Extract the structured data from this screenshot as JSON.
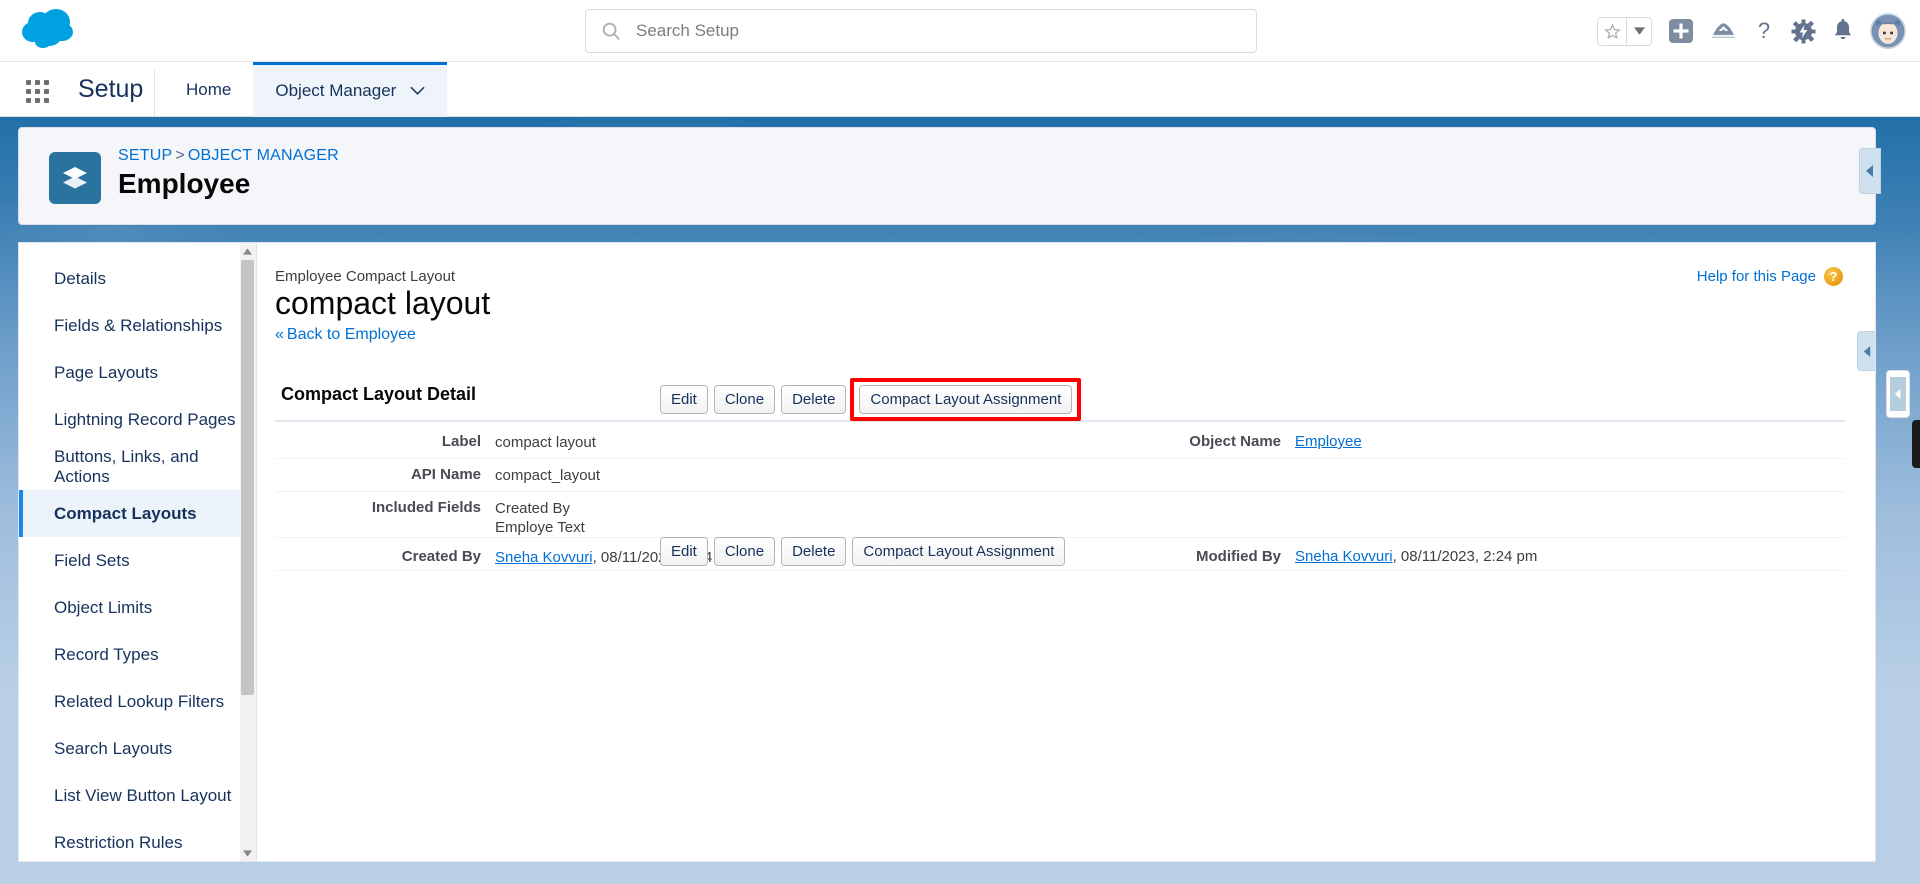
{
  "header": {
    "logo_name": "salesforce-cloud-logo",
    "search": {
      "placeholder": "Search Setup",
      "value": "",
      "icon": "search-icon"
    },
    "icons": [
      {
        "name": "favorites-star-icon",
        "glyph": "★"
      },
      {
        "name": "favorites-dropdown-icon",
        "glyph": "▾"
      },
      {
        "name": "add-icon",
        "glyph": "+"
      },
      {
        "name": "einstein-icon",
        "glyph": "⛰"
      },
      {
        "name": "help-icon",
        "glyph": "?"
      },
      {
        "name": "setup-gear-icon",
        "glyph": "⚙"
      },
      {
        "name": "notifications-bell-icon",
        "glyph": "🔔"
      },
      {
        "name": "user-avatar",
        "glyph": ""
      }
    ]
  },
  "setup_nav": {
    "app_launcher_label": "app-launcher",
    "setup_label": "Setup",
    "tabs": [
      {
        "label": "Home",
        "active": false,
        "has_caret": false
      },
      {
        "label": "Object Manager",
        "active": true,
        "has_caret": true
      }
    ]
  },
  "page_header": {
    "icon": "object-layers-icon",
    "breadcrumb": [
      {
        "label": "SETUP",
        "link": true
      },
      {
        "label": ">",
        "link": false
      },
      {
        "label": "OBJECT MANAGER",
        "link": true
      }
    ],
    "title": "Employee",
    "collapse_icon": "chevron-left-icon"
  },
  "sidebar": {
    "items": [
      {
        "label": "Details",
        "active": false
      },
      {
        "label": "Fields & Relationships",
        "active": false
      },
      {
        "label": "Page Layouts",
        "active": false
      },
      {
        "label": "Lightning Record Pages",
        "active": false
      },
      {
        "label": "Buttons, Links, and Actions",
        "active": false
      },
      {
        "label": "Compact Layouts",
        "active": true
      },
      {
        "label": "Field Sets",
        "active": false
      },
      {
        "label": "Object Limits",
        "active": false
      },
      {
        "label": "Record Types",
        "active": false
      },
      {
        "label": "Related Lookup Filters",
        "active": false
      },
      {
        "label": "Search Layouts",
        "active": false
      },
      {
        "label": "List View Button Layout",
        "active": false
      },
      {
        "label": "Restriction Rules",
        "active": false
      }
    ],
    "scrollbar": {
      "up_arrow": "scroll-up-arrow",
      "down_arrow": "scroll-down-arrow"
    }
  },
  "main": {
    "help_link": {
      "label": "Help for this Page",
      "icon": "help-question-icon"
    },
    "kicker": "Employee Compact Layout",
    "record_title": "compact layout",
    "back_link": {
      "guillemet": "«",
      "label": "Back to Employee"
    },
    "section_title": "Compact Layout Detail",
    "buttons": [
      {
        "label": "Edit",
        "highlighted": false
      },
      {
        "label": "Clone",
        "highlighted": false
      },
      {
        "label": "Delete",
        "highlighted": false
      },
      {
        "label": "Compact Layout Assignment",
        "highlighted": true
      }
    ],
    "highlight_color": "#ff0000",
    "detail_rows": [
      {
        "label": "Label",
        "value": "compact layout",
        "value_lines": [],
        "right_label": "Object Name",
        "right_value": "Employee",
        "right_is_link": true
      },
      {
        "label": "API Name",
        "value": "compact_layout",
        "value_lines": [],
        "right_label": "",
        "right_value": "",
        "right_is_link": false
      },
      {
        "label": "Included Fields",
        "value": "",
        "value_lines": [
          "Created By",
          "Employe Text"
        ],
        "right_label": "",
        "right_value": "",
        "right_is_link": false
      },
      {
        "label": "Created By",
        "value": "",
        "value_lines": [],
        "link_text": "Sneha Kovvuri",
        "suffix_text": ", 08/11/2023, 2:24 pm",
        "right_label": "Modified By",
        "right_link_text": "Sneha Kovvuri",
        "right_suffix_text": ", 08/11/2023, 2:24 pm",
        "right_is_link": true
      }
    ],
    "collapse_icon": "chevron-left-icon"
  },
  "colors": {
    "brand_blue": "#0070d2",
    "nav_active": "#eef4f9",
    "sidebar_active": "#ecf3fb",
    "banner_blue": "#1e6ca8",
    "highlight_red": "#ff0000"
  }
}
